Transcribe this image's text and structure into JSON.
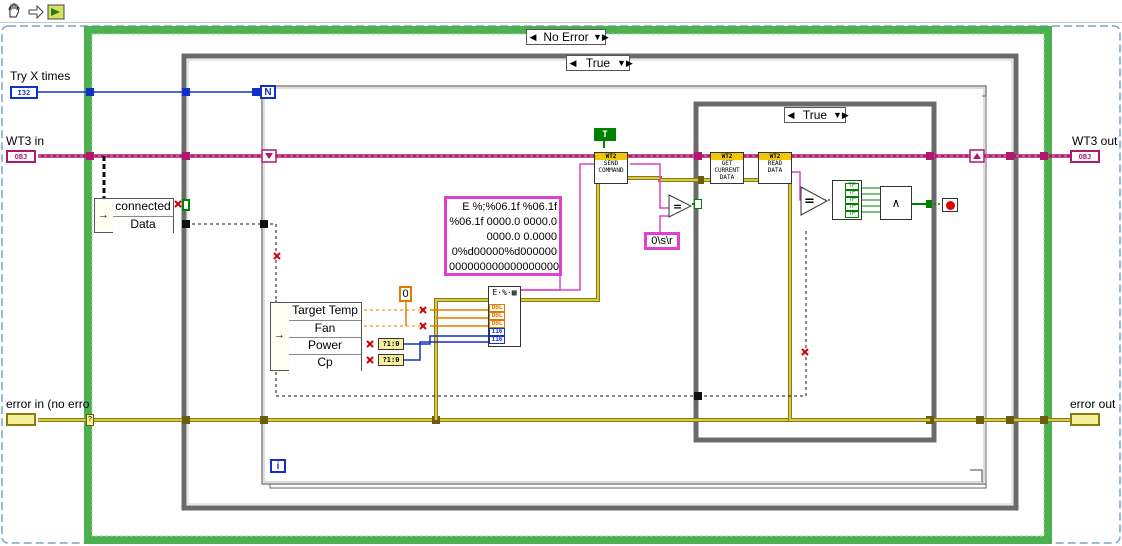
{
  "toolbar": {
    "items": [
      "hand-tool-icon",
      "step-arrow-icon",
      "run-vi-icon"
    ]
  },
  "structures": {
    "outer_case": "No Error",
    "inner_case": "True",
    "nested_case": "True"
  },
  "controls": {
    "try_label": "Try X times",
    "try_type": "I32",
    "wt3_in_label": "WT3 in",
    "wt3_in_type": "OBJ",
    "error_in_label": "error in (no erro",
    "wt3_out_label": "WT3 out",
    "wt3_out_type": "OBJ",
    "error_out_label": "error out",
    "loop_count": "N",
    "iteration": "i",
    "true_const": "T"
  },
  "unbundle_top": {
    "fields": [
      "connected",
      "Data"
    ]
  },
  "unbundle_bottom": {
    "fields": [
      "Target Temp",
      "Fan",
      "Power",
      "Cp"
    ]
  },
  "constants": {
    "zero": "0",
    "format_string": "E %;%06.1f %06.1f\n%06.1f 0000.0 0000.0\n0000.0 0.0000\n0%d00000%d000000\n000000000000000000",
    "terminator": "0\\s\\r",
    "to_int": "?1:0"
  },
  "vis": {
    "send": {
      "tag": "WT2",
      "name": "SEND\nCOMMAND"
    },
    "get": {
      "tag": "WT2",
      "name": "GET\nCURRENT\nDATA"
    },
    "read": {
      "tag": "WT2",
      "name": "READ\nDATA"
    }
  },
  "format_terms": [
    "DBL",
    "DBL",
    "DBL",
    "I16",
    "I16"
  ],
  "bool_array": [
    "TF",
    "TF",
    "TF",
    "TF",
    "TF"
  ],
  "colors": {
    "background": "#ffffff",
    "while_loop_border": "#37a337",
    "case_border": "#6f6f6f",
    "class_wire": "#b0176f",
    "error_wire": "#c8b400",
    "numeric_wire": "#1030c8",
    "string_wire": "#e040d0",
    "boolean_wire": "#008000",
    "stop_button": "#e00000"
  }
}
